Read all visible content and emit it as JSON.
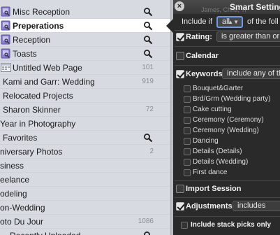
{
  "library": {
    "items": [
      {
        "label": "Misc Reception",
        "icon": "smart-album-icon",
        "smart": true
      },
      {
        "label": "Preperations",
        "icon": "smart-album-icon",
        "smart": true,
        "selected": true
      },
      {
        "label": "Reception",
        "icon": "smart-album-icon",
        "smart": true
      },
      {
        "label": "Toasts",
        "icon": "smart-album-icon",
        "smart": true
      },
      {
        "label": "Untitled Web Page",
        "icon": "web-page-icon",
        "count": "101"
      },
      {
        "label": "Kami and Garr: Wedding",
        "count": "919"
      },
      {
        "label": "Relocated Projects"
      },
      {
        "label": "Sharon Skinner",
        "count": "72"
      },
      {
        "label": "Year in Photography"
      },
      {
        "label": "Favorites",
        "smart": true
      },
      {
        "label": "niversary Photos",
        "count": "2"
      },
      {
        "label": "siness"
      },
      {
        "label": "eelance"
      },
      {
        "label": "odeling"
      },
      {
        "label": "on-Wedding"
      },
      {
        "label": "oto Du Jour",
        "count": "1086"
      },
      {
        "label": "Recently Uploaded",
        "smart": true
      }
    ]
  },
  "hud": {
    "title": "Smart Settings:",
    "subtitle": "James, Chris, Ti",
    "include_prefix": "Include if",
    "include_value": "all",
    "include_suffix": "of the foll",
    "rating_label": "Rating:",
    "rating_op": "is greater than or e",
    "calendar_label": "Calendar",
    "keywords_label": "Keywords",
    "keywords_op": "include any of th",
    "keyword_list": [
      "Bouquet&Garter",
      "Brd/Grm (Wedding party)",
      "Cake cutting",
      "Ceremony (Ceremony)",
      "Ceremony (Wedding)",
      "Dancing",
      "Details (Details)",
      "Details (Wedding)",
      "First dance"
    ],
    "import_label": "Import Session",
    "adjustments_label": "Adjustments:",
    "adjustments_op": "includes",
    "stack_label": "Include stack picks only",
    "close_glyph": "×",
    "popup_arrow": "▲▼"
  }
}
